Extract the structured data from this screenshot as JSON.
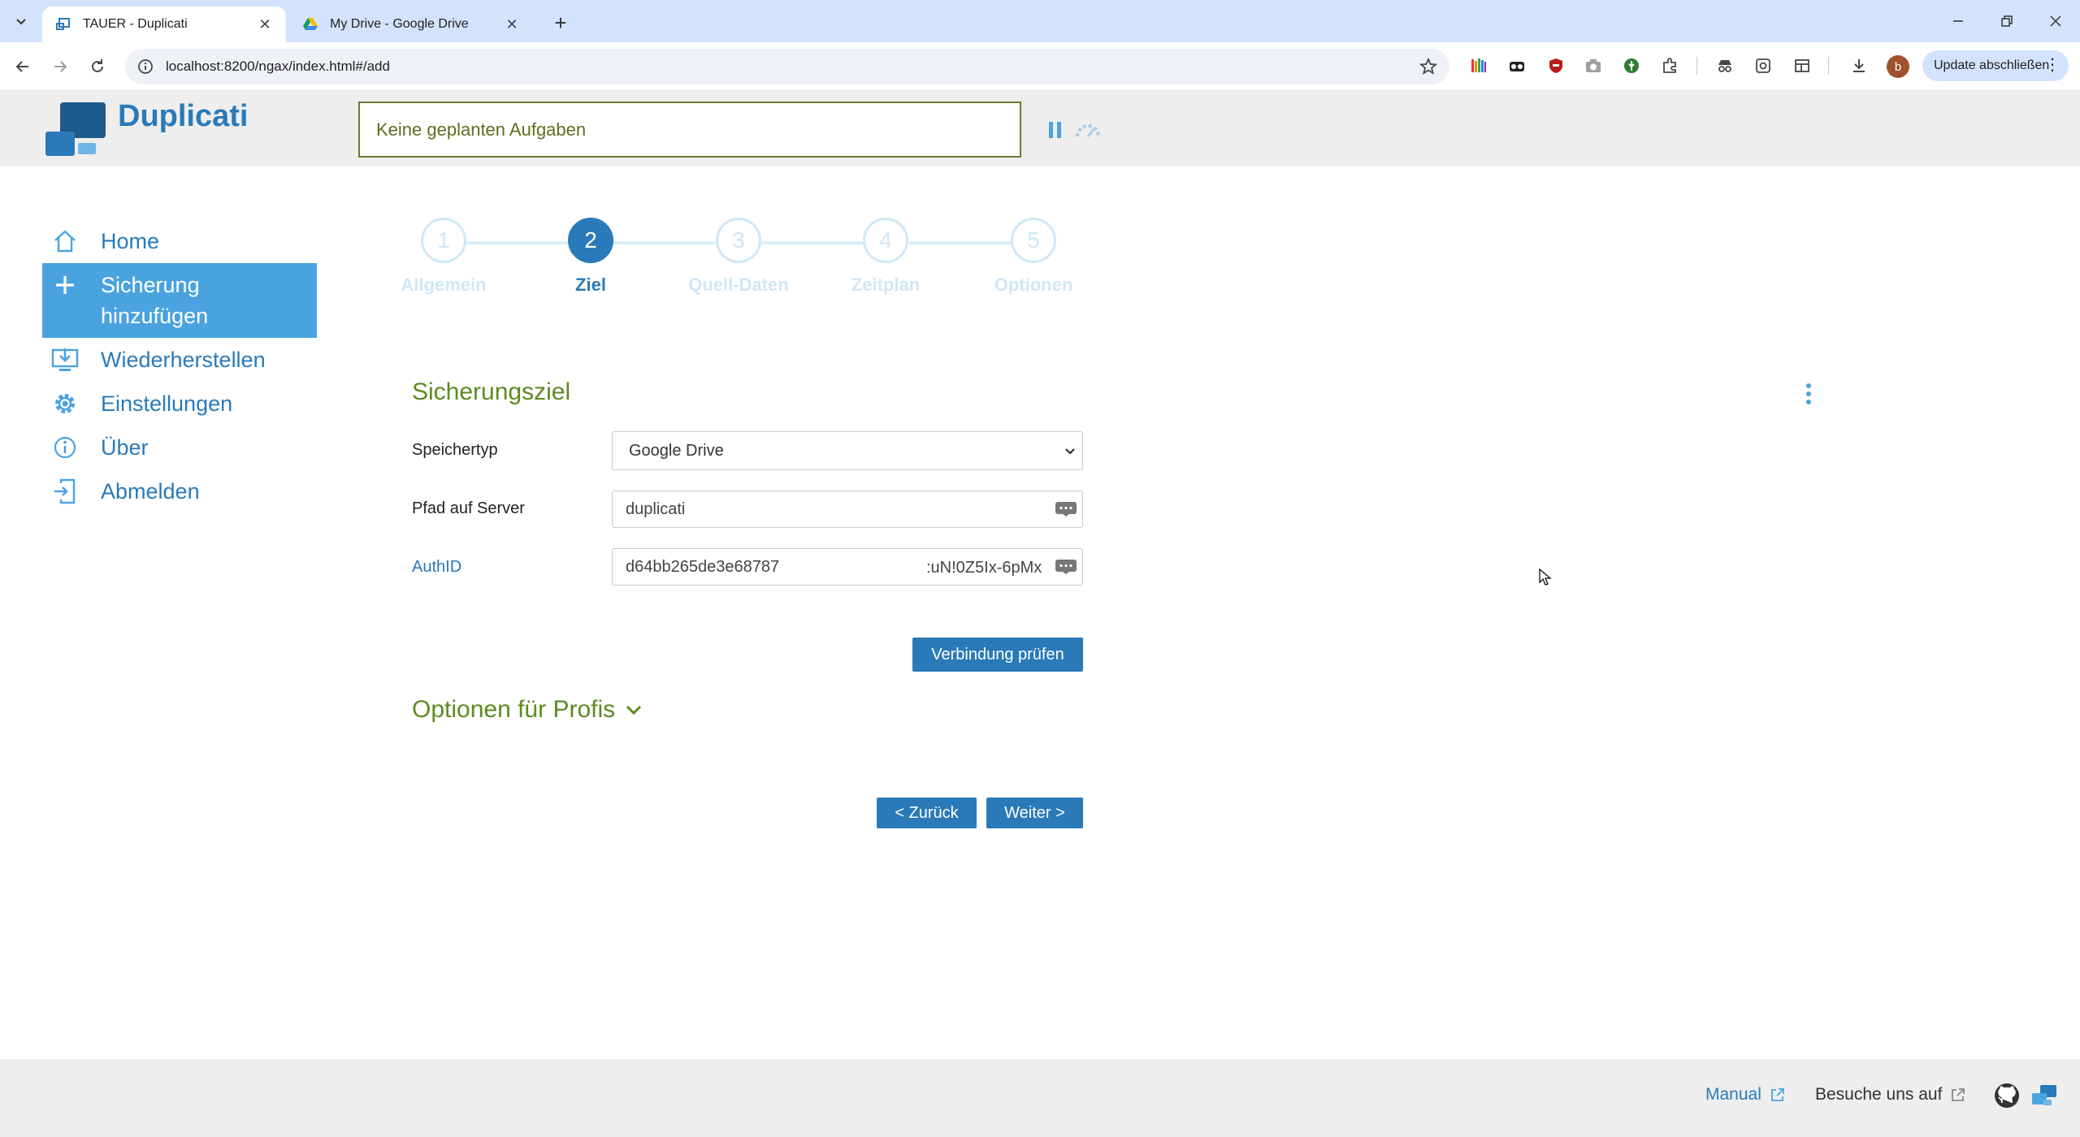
{
  "browser": {
    "tabs": [
      {
        "title": "TAUER - Duplicati",
        "active": true
      },
      {
        "title": "My Drive - Google Drive",
        "active": false
      }
    ],
    "url": "localhost:8200/ngax/index.html#/add",
    "update_label": "Update abschließen",
    "avatar_letter": "b"
  },
  "header": {
    "brand": "Duplicati",
    "status": "Keine geplanten Aufgaben"
  },
  "sidebar": {
    "items": [
      {
        "label": "Home",
        "icon": "home-icon"
      },
      {
        "label": "Sicherung hinzufügen",
        "icon": "plus-icon"
      },
      {
        "label": "Wiederherstellen",
        "icon": "restore-icon"
      },
      {
        "label": "Einstellungen",
        "icon": "gear-icon"
      },
      {
        "label": "Über",
        "icon": "info-icon"
      },
      {
        "label": "Abmelden",
        "icon": "logout-icon"
      }
    ]
  },
  "wizard": {
    "steps": [
      {
        "number": "1",
        "label": "Allgemein"
      },
      {
        "number": "2",
        "label": "Ziel"
      },
      {
        "number": "3",
        "label": "Quell-Daten"
      },
      {
        "number": "4",
        "label": "Zeitplan"
      },
      {
        "number": "5",
        "label": "Optionen"
      }
    ],
    "current_step": 2
  },
  "form": {
    "title": "Sicherungsziel",
    "storage_type_label": "Speichertyp",
    "storage_type_value": "Google Drive",
    "path_label": "Pfad auf Server",
    "path_value": "duplicati",
    "authid_label": "AuthID",
    "authid_value_start": "d64bb265de3e68787",
    "authid_value_end": ":uN!0Z5Ix-6pMx",
    "test_button": "Verbindung prüfen",
    "advanced_label": "Optionen für Profis",
    "back_button": "< Zurück",
    "next_button": "Weiter >"
  },
  "footer": {
    "manual": "Manual",
    "visit": "Besuche uns auf"
  },
  "colors": {
    "accent": "#2a7ab9",
    "sidebar_active": "#4aa3df",
    "section_green": "#5d8a1f",
    "status_border": "#6b7a2c"
  }
}
